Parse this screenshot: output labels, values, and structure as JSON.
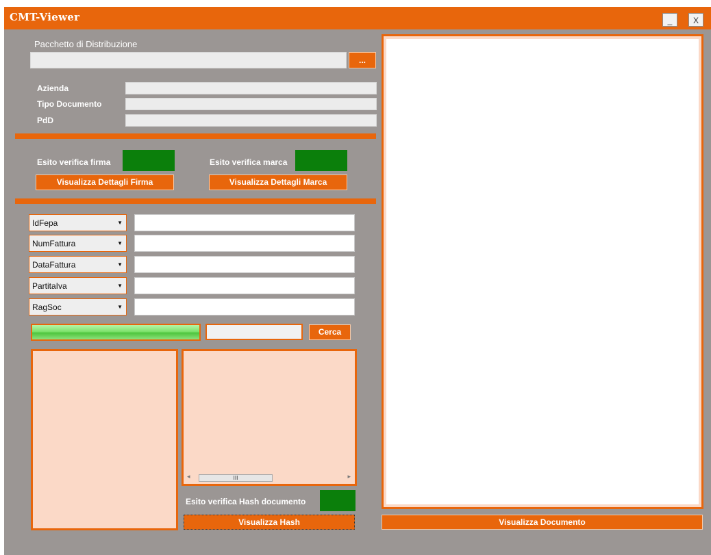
{
  "window": {
    "title": "CMT-Viewer",
    "minimize": "_",
    "close": "X"
  },
  "package": {
    "label": "Pacchetto di Distribuzione",
    "value": "",
    "browse_label": "..."
  },
  "info": {
    "azienda_label": "Azienda",
    "tipo_documento_label": "Tipo Documento",
    "pdd_label": "PdD"
  },
  "verify": {
    "firma_label": "Esito verifica firma",
    "marca_label": "Esito verifica marca",
    "firma_button": "Visualizza Dettagli Firma",
    "marca_button": "Visualizza Dettagli Marca",
    "status_color": "#0b7f0b"
  },
  "filters": [
    {
      "field": "IdFepa",
      "value": ""
    },
    {
      "field": "NumFattura",
      "value": ""
    },
    {
      "field": "DataFattura",
      "value": ""
    },
    {
      "field": "PartitaIva",
      "value": ""
    },
    {
      "field": "RagSoc",
      "value": ""
    }
  ],
  "search": {
    "button": "Cerca",
    "value": ""
  },
  "hash": {
    "label": "Esito verifica Hash documento",
    "button": "Visualizza Hash"
  },
  "document": {
    "button": "Visualizza Documento"
  },
  "scrollbar": {
    "grip": "III",
    "left_arrow": "◂",
    "right_arrow": "▸"
  },
  "colors": {
    "accent": "#e8660c",
    "background": "#9b9694",
    "panel": "#fbd9c7",
    "ok": "#0b7f0b"
  }
}
